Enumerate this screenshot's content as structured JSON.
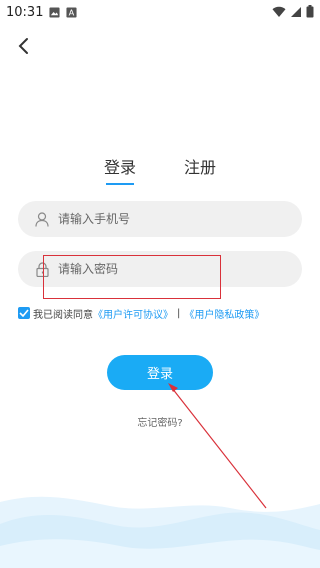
{
  "status_bar": {
    "time": "10:31",
    "icons_left": [
      "image-icon",
      "a-icon"
    ],
    "icons_right": [
      "wifi-icon",
      "signal-icon",
      "battery-icon"
    ]
  },
  "nav": {
    "back_icon": "chevron-left-icon"
  },
  "tabs": [
    {
      "label": "登录",
      "active": true
    },
    {
      "label": "注册",
      "active": false
    }
  ],
  "form": {
    "phone": {
      "placeholder": "请输入手机号",
      "value": "",
      "icon": "user-icon"
    },
    "password": {
      "placeholder": "请输入密码",
      "value": "",
      "icon": "lock-icon"
    }
  },
  "agreement": {
    "checked": true,
    "prefix": "我已阅读同意",
    "user_license": "《用户许可协议》",
    "separator": "|",
    "privacy_policy": "《用户隐私政策》"
  },
  "login_button": {
    "label": "登录"
  },
  "forgot_password": {
    "label": "忘记密码?"
  },
  "colors": {
    "accent": "#1E9BF3",
    "button": "#1AABF5",
    "input_bg": "#f0f0f0",
    "annotation_red": "#d9313a",
    "wave": "#d8eefb"
  }
}
